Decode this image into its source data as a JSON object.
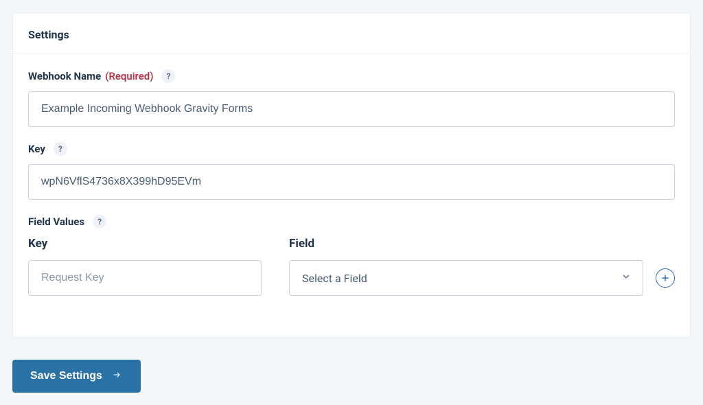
{
  "card_title": "Settings",
  "webhook_name": {
    "label": "Webhook Name",
    "required_text": "(Required)",
    "help_glyph": "?",
    "value": "Example Incoming Webhook Gravity Forms"
  },
  "key_field": {
    "label": "Key",
    "help_glyph": "?",
    "value": "wpN6VflS4736x8X399hD95EVm"
  },
  "field_values": {
    "label": "Field Values",
    "help_glyph": "?",
    "columns": {
      "key_heading": "Key",
      "field_heading": "Field"
    },
    "row": {
      "key_placeholder": "Request Key",
      "field_selected": "Select a Field"
    }
  },
  "save_button_label": "Save Settings",
  "colors": {
    "page_bg": "#f4f7fa",
    "primary_button": "#2a72a5",
    "required": "#b7263b",
    "border": "#c9d1df"
  }
}
